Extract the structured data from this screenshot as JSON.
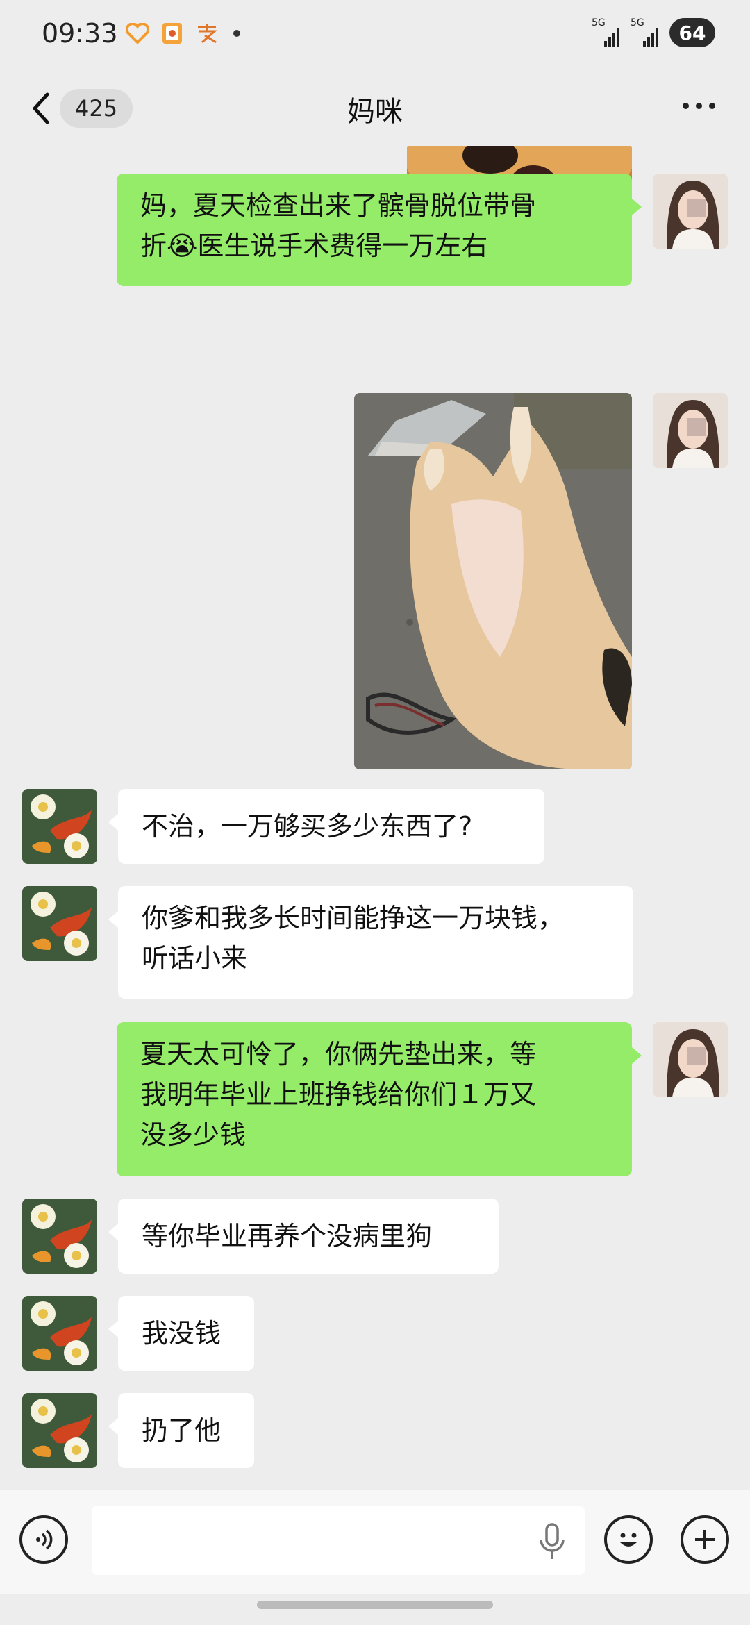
{
  "status_bar": {
    "time": "09:33",
    "icons": [
      "heart-link-icon",
      "red-packet-icon",
      "alipay-icon",
      "dot-icon"
    ],
    "signal_1_label": "5G",
    "signal_2_label": "5G",
    "battery": "64"
  },
  "header": {
    "unread_count": "425",
    "title": "妈咪"
  },
  "messages": [
    {
      "side": "me",
      "type": "image",
      "desc": "cartoon-bear-image"
    },
    {
      "side": "me",
      "type": "text",
      "line1": "妈，夏天检查出来了髌骨脱位带骨",
      "line2_pre": "折",
      "emoji": "😭",
      "line2_post": "医生说手术费得一万左右"
    },
    {
      "side": "me",
      "type": "image",
      "desc": "injured-dog-photo"
    },
    {
      "side": "other",
      "type": "text",
      "text": "不治，一万够买多少东西了?"
    },
    {
      "side": "other",
      "type": "text",
      "line1": "你爹和我多长时间能挣这一万块钱，",
      "line2": "听话小来"
    },
    {
      "side": "me",
      "type": "text",
      "line1": "夏天太可怜了，你俩先垫出来，等",
      "line2": "我明年毕业上班挣钱给你们１万又",
      "line3": "没多少钱"
    },
    {
      "side": "other",
      "type": "text",
      "text": "等你毕业再养个没病里狗"
    },
    {
      "side": "other",
      "type": "text",
      "text": "我没钱"
    },
    {
      "side": "other",
      "type": "text",
      "text": "扔了他"
    }
  ],
  "colors": {
    "background": "#ededed",
    "my_bubble": "#95ec69",
    "other_bubble": "#ffffff"
  }
}
